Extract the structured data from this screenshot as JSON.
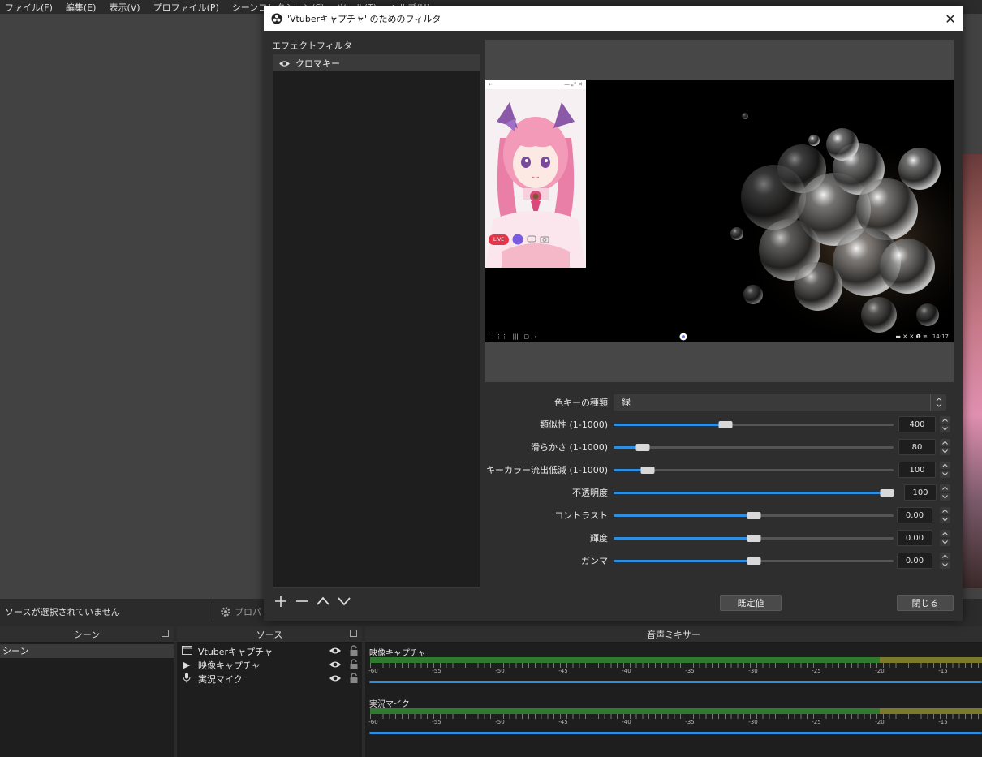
{
  "menu": [
    "ファイル(F)",
    "編集(E)",
    "表示(V)",
    "プロファイル(P)",
    "シーンコレクション(S)",
    "ツール(T)",
    "ヘルプ(H)"
  ],
  "status": {
    "no_source": "ソースが選択されていません",
    "properties": "プロパ"
  },
  "docks": {
    "scenes": {
      "title": "シーン",
      "items": [
        "シーン"
      ]
    },
    "sources": {
      "title": "ソース",
      "items": [
        {
          "label": "Vtuberキャプチャ",
          "icon": "window-capture-icon"
        },
        {
          "label": "映像キャプチャ",
          "icon": "play-icon"
        },
        {
          "label": "実況マイク",
          "icon": "microphone-icon"
        }
      ]
    },
    "mixer": {
      "title": "音声ミキサー",
      "channels": [
        {
          "name": "映像キャプチャ"
        },
        {
          "name": "実況マイク"
        }
      ],
      "scale": [
        "-60",
        "-55",
        "-50",
        "-45",
        "-40",
        "-35",
        "-30",
        "-25",
        "-20",
        "-15"
      ]
    }
  },
  "dialog": {
    "title": "'Vtuberキャプチャ' のためのフィルタ",
    "close": "✕",
    "effect_filters_label": "エフェクトフィルタ",
    "filters": [
      {
        "label": "クロマキー"
      }
    ],
    "preview": {
      "phone_live": "LIVE",
      "clock": "14:17"
    },
    "color_key": {
      "label": "色キーの種類",
      "value": "緑"
    },
    "properties": [
      {
        "label": "類似性 (1-1000)",
        "value": "400",
        "level": 0.4
      },
      {
        "label": "滑らかさ (1-1000)",
        "value": "80",
        "level": 0.105
      },
      {
        "label": "キーカラー流出低減 (1-1000)",
        "value": "100",
        "level": 0.122
      },
      {
        "label": "不透明度",
        "value": "100",
        "level": 1.0
      },
      {
        "label": "コントラスト",
        "value": "0.00",
        "level": 0.5
      },
      {
        "label": "輝度",
        "value": "0.00",
        "level": 0.5
      },
      {
        "label": "ガンマ",
        "value": "0.00",
        "level": 0.5
      }
    ],
    "defaults_button": "既定値",
    "close_button": "閉じる"
  },
  "colors": {
    "accent": "#2e8ee0",
    "meter_green": "#2f7a2f",
    "meter_yellow": "#7a7a2a",
    "live": "#e8334a"
  }
}
